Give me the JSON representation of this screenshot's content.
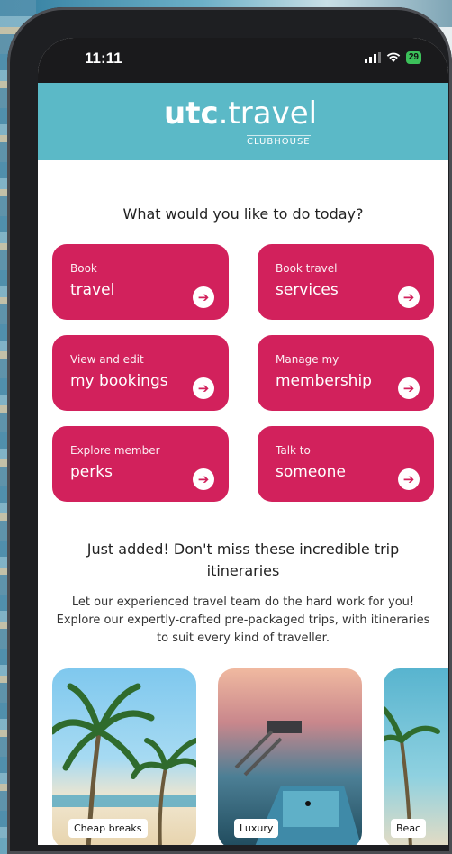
{
  "status": {
    "time": "11:11",
    "battery": "29"
  },
  "brand": {
    "name_bold": "utc",
    "name_rest": ".travel",
    "sub": "CLUBHOUSE"
  },
  "question": "What would you like to do today?",
  "actions": [
    {
      "line1": "Book",
      "line2": "travel"
    },
    {
      "line1": "Book travel",
      "line2": "services"
    },
    {
      "line1": "View and edit",
      "line2": "my bookings"
    },
    {
      "line1": "Manage my",
      "line2": "membership"
    },
    {
      "line1": "Explore member",
      "line2": "perks"
    },
    {
      "line1": "Talk to",
      "line2": "someone"
    }
  ],
  "itineraries": {
    "title": "Just added! Don't miss these incredible trip itineraries",
    "body": "Let our experienced travel team do the hard work for you! Explore our expertly-crafted pre-packaged trips, with itineraries to suit every kind of traveller.",
    "cards": [
      {
        "label": "Cheap breaks"
      },
      {
        "label": "Luxury"
      },
      {
        "label": "Beac"
      }
    ]
  },
  "icons": {
    "arrow": "arrow-right-circle-icon",
    "signal": "signal-icon",
    "wifi": "wifi-icon",
    "battery": "battery-icon"
  },
  "colors": {
    "header": "#5bb9c7",
    "card": "#d2215c"
  }
}
